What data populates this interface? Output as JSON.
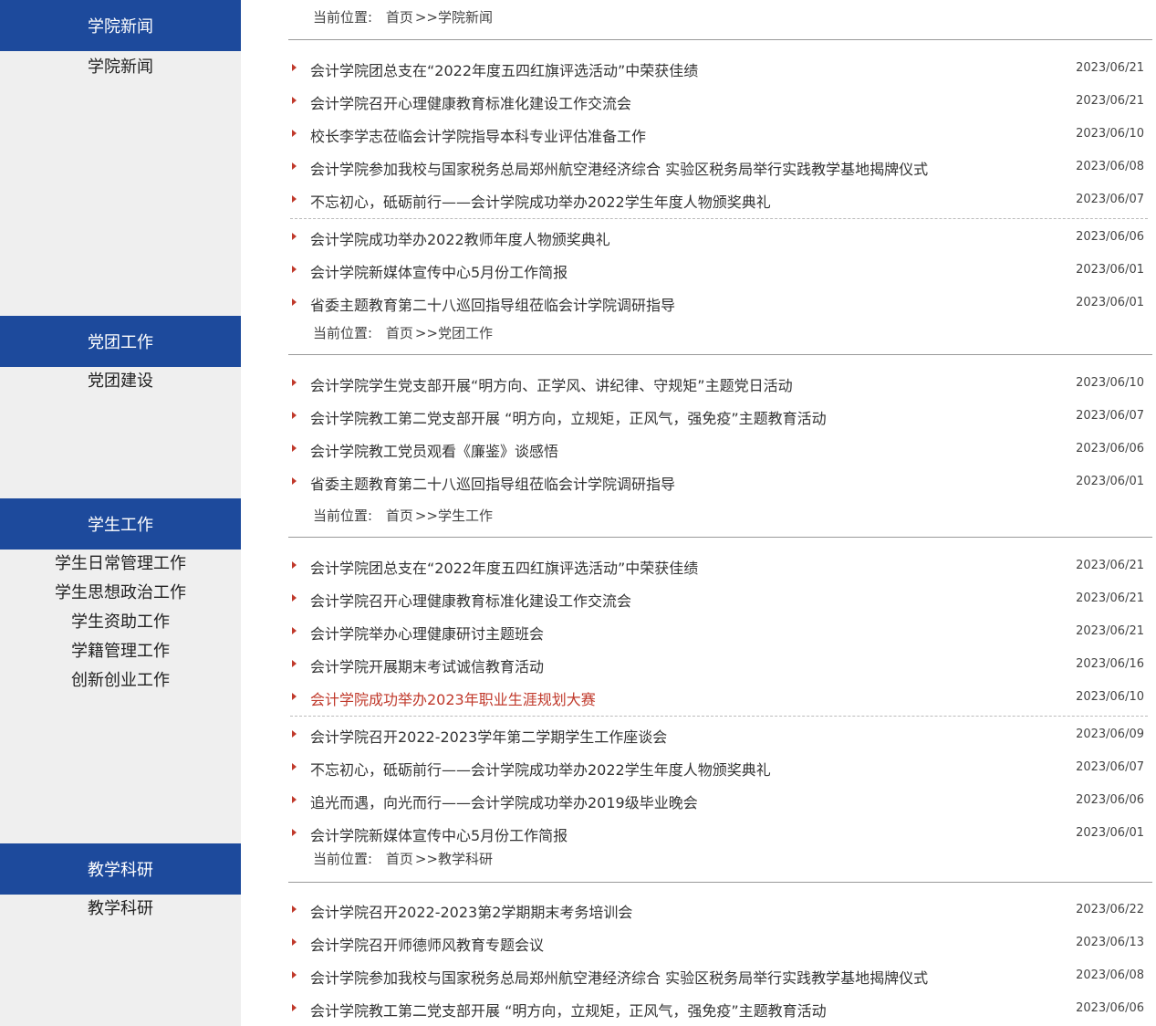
{
  "sections": [
    {
      "header": "学院新闻",
      "side_links": [
        "学院新闻"
      ],
      "breadcrumb": {
        "prefix": "当前位置:",
        "home": "首页",
        "arrow": ">>",
        "current": "学院新闻"
      },
      "items": [
        {
          "title": "会计学院团总支在“2022年度五四红旗评选活动”中荣获佳绩",
          "date": "2023/06/21"
        },
        {
          "title": "会计学院召开心理健康教育标准化建设工作交流会",
          "date": "2023/06/21"
        },
        {
          "title": "校长李学志莅临会计学院指导本科专业评估准备工作",
          "date": "2023/06/10"
        },
        {
          "title": "会计学院参加我校与国家税务总局郑州航空港经济综合 实验区税务局举行实践教学基地揭牌仪式",
          "date": "2023/06/08"
        },
        {
          "title": "不忘初心，砥砺前行——会计学院成功举办2022学生年度人物颁奖典礼",
          "date": "2023/06/07"
        },
        {
          "title": "会计学院成功举办2022教师年度人物颁奖典礼",
          "date": "2023/06/06"
        },
        {
          "title": "会计学院新媒体宣传中心5月份工作简报",
          "date": "2023/06/01"
        },
        {
          "title": "省委主题教育第二十八巡回指导组莅临会计学院调研指导",
          "date": "2023/06/01"
        }
      ]
    },
    {
      "header": "党团工作",
      "side_links": [
        "党团建设"
      ],
      "breadcrumb": {
        "prefix": "当前位置:",
        "home": "首页",
        "arrow": ">>",
        "current": "党团工作"
      },
      "items": [
        {
          "title": "会计学院学生党支部开展“明方向、正学风、讲纪律、守规矩”主题党日活动",
          "date": "2023/06/10"
        },
        {
          "title": "会计学院教工第二党支部开展 “明方向，立规矩，正风气，强免疫”主题教育活动",
          "date": "2023/06/07"
        },
        {
          "title": "会计学院教工党员观看《廉鉴》谈感悟",
          "date": "2023/06/06"
        },
        {
          "title": "省委主题教育第二十八巡回指导组莅临会计学院调研指导",
          "date": "2023/06/01"
        }
      ]
    },
    {
      "header": "学生工作",
      "side_links": [
        "学生日常管理工作",
        "学生思想政治工作",
        "学生资助工作",
        "学籍管理工作",
        "创新创业工作"
      ],
      "breadcrumb": {
        "prefix": "当前位置:",
        "home": "首页",
        "arrow": ">>",
        "current": "学生工作"
      },
      "items": [
        {
          "title": "会计学院团总支在“2022年度五四红旗评选活动”中荣获佳绩",
          "date": "2023/06/21"
        },
        {
          "title": "会计学院召开心理健康教育标准化建设工作交流会",
          "date": "2023/06/21"
        },
        {
          "title": "会计学院举办心理健康研讨主题班会",
          "date": "2023/06/21"
        },
        {
          "title": "会计学院开展期末考试诚信教育活动",
          "date": "2023/06/16"
        },
        {
          "title": "会计学院成功举办2023年职业生涯规划大赛",
          "date": "2023/06/10",
          "highlight": true
        },
        {
          "title": "会计学院召开2022-2023学年第二学期学生工作座谈会",
          "date": "2023/06/09"
        },
        {
          "title": "不忘初心，砥砺前行——会计学院成功举办2022学生年度人物颁奖典礼",
          "date": "2023/06/07"
        },
        {
          "title": "追光而遇，向光而行——会计学院成功举办2019级毕业晚会",
          "date": "2023/06/06"
        },
        {
          "title": "会计学院新媒体宣传中心5月份工作简报",
          "date": "2023/06/01"
        }
      ]
    },
    {
      "header": "教学科研",
      "side_links": [
        "教学科研"
      ],
      "breadcrumb": {
        "prefix": "当前位置:",
        "home": "首页",
        "arrow": ">>",
        "current": "教学科研"
      },
      "items": [
        {
          "title": "会计学院召开2022-2023第2学期期末考务培训会",
          "date": "2023/06/22"
        },
        {
          "title": "会计学院召开师德师风教育专题会议",
          "date": "2023/06/13"
        },
        {
          "title": "会计学院参加我校与国家税务总局郑州航空港经济综合 实验区税务局举行实践教学基地揭牌仪式",
          "date": "2023/06/08"
        },
        {
          "title": "会计学院教工第二党支部开展 “明方向，立规矩，正风气，强免疫”主题教育活动",
          "date": "2023/06/06"
        }
      ]
    }
  ],
  "colors": {
    "header_bg": "#1d4a9c",
    "sidebar_bg": "#efefef",
    "bullet": "#c0392b",
    "highlight": "#c0392b"
  }
}
